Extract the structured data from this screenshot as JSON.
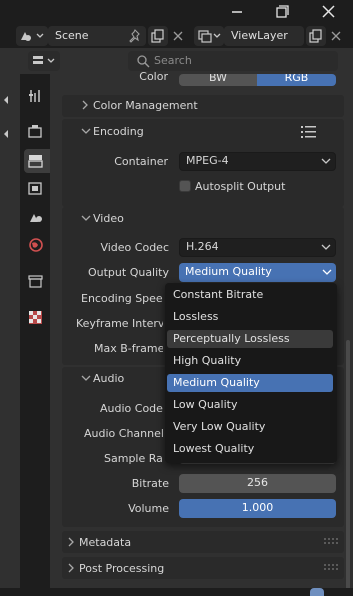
{
  "window": {
    "minimize_icon": "minimize-icon",
    "maximize_icon": "maximize-icon",
    "close_icon": "close-icon"
  },
  "topbar": {
    "scene_label": "Scene",
    "viewlayer_label": "ViewLayer"
  },
  "header": {
    "search_placeholder": "Search"
  },
  "color": {
    "label": "Color",
    "options": [
      "BW",
      "RGB"
    ],
    "selected": "RGB"
  },
  "color_management": {
    "label": "Color Management"
  },
  "encoding": {
    "label": "Encoding",
    "container_label": "Container",
    "container_value": "MPEG-4",
    "autosplit_label": "Autosplit Output"
  },
  "video": {
    "label": "Video",
    "codec_label": "Video Codec",
    "codec_value": "H.264",
    "quality_label": "Output Quality",
    "quality_value": "Medium Quality",
    "encoding_speed_label": "Encoding Speed",
    "keyframe_label": "Keyframe Interval",
    "bframes_label": "Max B-frames"
  },
  "audio": {
    "label": "Audio",
    "codec_label": "Audio Codec",
    "channels_label": "Audio Channels",
    "sample_rate_label": "Sample Rate",
    "bitrate_label": "Bitrate",
    "bitrate_value": "256",
    "volume_label": "Volume",
    "volume_value": "1.000"
  },
  "metadata": {
    "label": "Metadata"
  },
  "post_processing": {
    "label": "Post Processing"
  },
  "dropdown": {
    "options": [
      {
        "label": "Constant Bitrate",
        "state": "normal"
      },
      {
        "label": "Lossless",
        "state": "normal"
      },
      {
        "label": "Perceptually Lossless",
        "state": "hover"
      },
      {
        "label": "High Quality",
        "state": "normal"
      },
      {
        "label": "Medium Quality",
        "state": "selected"
      },
      {
        "label": "Low Quality",
        "state": "normal"
      },
      {
        "label": "Very Low Quality",
        "state": "normal"
      },
      {
        "label": "Lowest Quality",
        "state": "normal"
      }
    ]
  },
  "colors": {
    "accent": "#4772b3",
    "panel": "#303030",
    "background": "#1d1d1d"
  }
}
